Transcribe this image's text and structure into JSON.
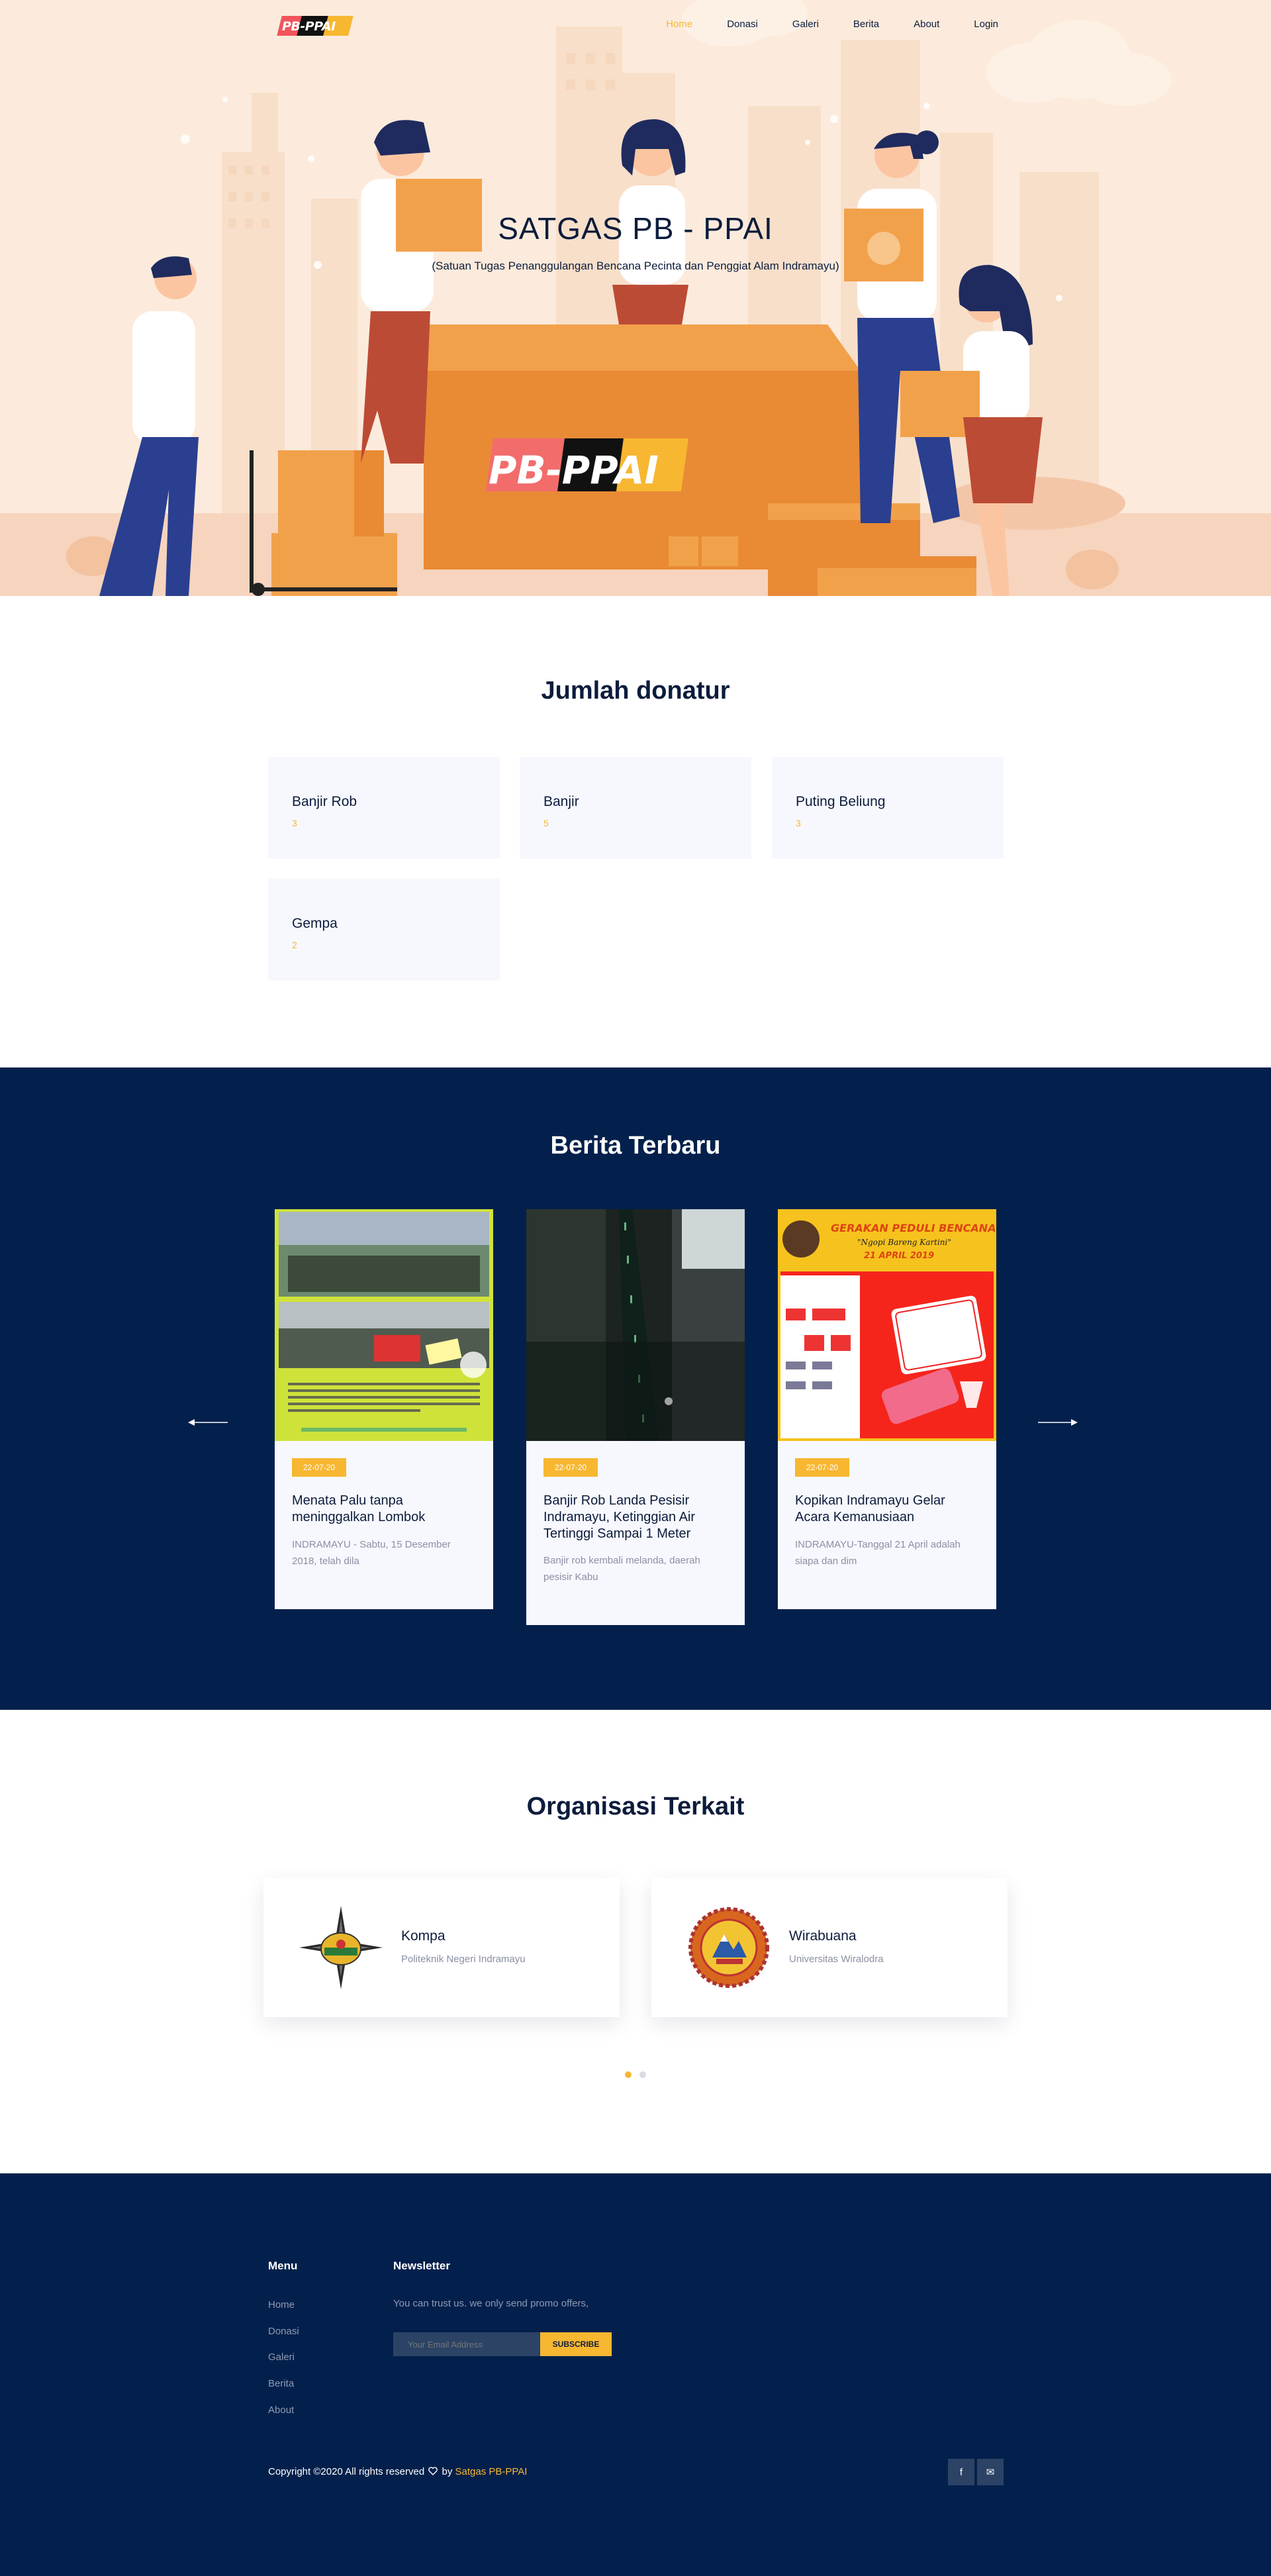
{
  "nav": {
    "logo_text": "PB-PPAI",
    "items": [
      {
        "label": "Home",
        "active": true
      },
      {
        "label": "Donasi",
        "active": false
      },
      {
        "label": "Galeri",
        "active": false
      },
      {
        "label": "Berita",
        "active": false
      },
      {
        "label": "About",
        "active": false
      },
      {
        "label": "Login",
        "active": false
      }
    ]
  },
  "hero": {
    "title": "SATGAS PB - PPAI",
    "subtitle": "(Satuan Tugas Penanggulangan Bencana Pecinta dan Penggiat Alam Indramayu)",
    "box_logo_text": "PB-PPAI"
  },
  "donatur": {
    "title": "Jumlah donatur",
    "cards": [
      {
        "name": "Banjir Rob",
        "count": "3"
      },
      {
        "name": "Banjir",
        "count": "5"
      },
      {
        "name": "Puting Beliung",
        "count": "3"
      },
      {
        "name": "Gempa",
        "count": "2"
      }
    ]
  },
  "berita": {
    "title": "Berita Terbaru",
    "prev_icon": "arrow-left-icon",
    "next_icon": "arrow-right-icon",
    "items": [
      {
        "date": "22-07-20",
        "title": "Menata Palu tanpa meninggalkan Lombok",
        "excerpt": "INDRAMAYU - Sabtu, 15 Desember 2018, telah dila"
      },
      {
        "date": "22-07-20",
        "title": "Banjir Rob Landa Pesisir Indramayu, Ketinggian Air Tertinggi Sampai 1 Meter",
        "excerpt": "Banjir rob kembali melanda, daerah pesisir Kabu"
      },
      {
        "date": "22-07-20",
        "title": "Kopikan Indramayu Gelar Acara Kemanusiaan",
        "excerpt": "INDRAMAYU-Tanggal 21 April adalah siapa dan dim"
      }
    ],
    "poster": {
      "heading": "GERAKAN PEDULI BENCANA",
      "tagline": "\"Ngopi Bareng Kartini\"",
      "date": "21 APRIL 2019"
    }
  },
  "organisasi": {
    "title": "Organisasi Terkait",
    "items": [
      {
        "name": "Kompa",
        "subtitle": "Politeknik Negeri Indramayu"
      },
      {
        "name": "Wirabuana",
        "subtitle": "Universitas Wiralodra"
      }
    ],
    "pages": 2,
    "current_page": 1
  },
  "footer": {
    "menu_title": "Menu",
    "menu": [
      "Home",
      "Donasi",
      "Galeri",
      "Berita",
      "About"
    ],
    "newsletter_title": "Newsletter",
    "newsletter_text": "You can trust us. we only send promo offers,",
    "email_placeholder": "Your Email Address",
    "subscribe_label": "SUBSCRIBE",
    "copyright_prefix": "Copyright ©2020 All rights reserved",
    "copyright_by": "by",
    "copyright_brand": "Satgas PB-PPAI",
    "social": [
      {
        "icon": "facebook-icon",
        "glyph": "f"
      },
      {
        "icon": "mail-icon",
        "glyph": "✉"
      }
    ]
  },
  "colors": {
    "accent": "#f7b731",
    "navy": "#03204c",
    "text": "#0c1c3c",
    "hero_bg": "#fcebdc"
  }
}
